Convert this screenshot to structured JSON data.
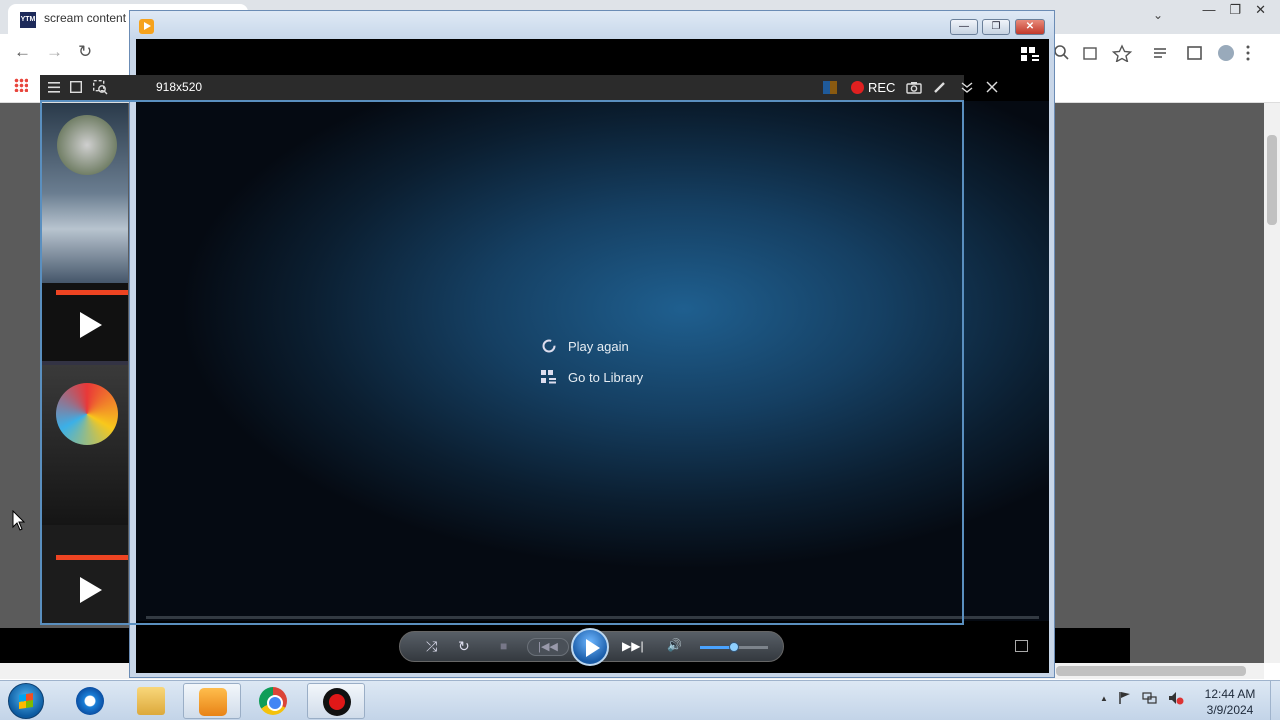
{
  "browser": {
    "tab_title": "scream content",
    "favicon_text": "YTM",
    "nav": {
      "back": "←",
      "forward": "→",
      "reload": "↻"
    },
    "window_controls": [
      "—",
      "❐",
      "✕"
    ],
    "tab_dropdown": "⌄",
    "toolbar_icons": [
      "search-icon",
      "share-icon",
      "star-icon",
      "media-icon",
      "sidebar-icon",
      "profile-icon",
      "menu-icon"
    ]
  },
  "recorder": {
    "size_label": "918x520",
    "rec_label": "REC"
  },
  "player": {
    "window_buttons": {
      "minimize": "—",
      "maximize": "❐",
      "close": "✕"
    },
    "end_menu": {
      "play_again": "Play again",
      "go_to_library": "Go to Library"
    },
    "controls": {
      "shuffle": "⤮",
      "repeat": "↻",
      "stop": "■",
      "prev": "|◀◀",
      "next": "▶▶|",
      "volume": "🔊",
      "volume_level": 0.5
    },
    "accent_color": "#1a5ca8"
  },
  "taskbar": {
    "clock_time": "12:44 AM",
    "clock_date": "3/9/2024",
    "tray_up": "▲"
  }
}
